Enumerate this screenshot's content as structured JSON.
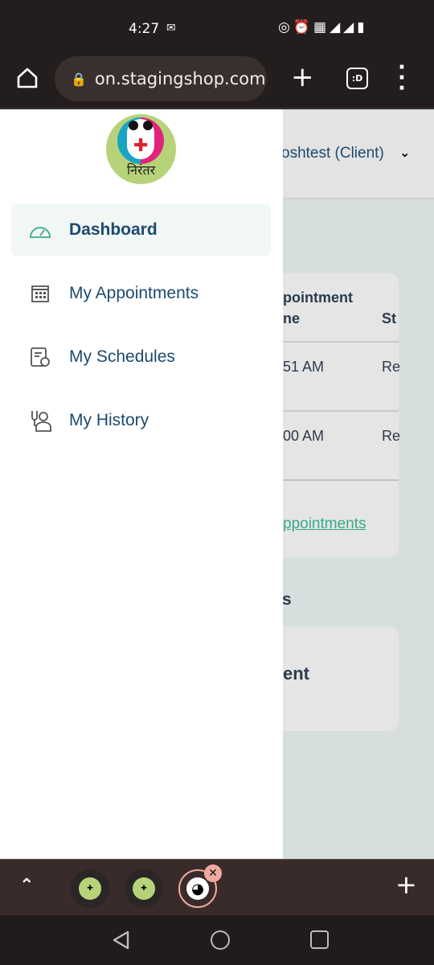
{
  "status_bar": {
    "time": "4:27",
    "icons": [
      "outlook-icon",
      "hotspot-icon",
      "alarm-icon",
      "volte-icon",
      "5g-signal-icon",
      "signal-icon",
      "battery-icon"
    ]
  },
  "browser": {
    "url": "on.stagingshop.com",
    "tab_count_label": ":D"
  },
  "background_page": {
    "user_menu": "oshtest (Client)",
    "table_header_1a": "pointment",
    "table_header_1b": "ne",
    "table_header_2": "St",
    "rows": [
      {
        "time": "51 AM",
        "status": "Re"
      },
      {
        "time": "00 AM",
        "status": "Re"
      }
    ],
    "view_all_link": "ppointments",
    "section_heading": "s",
    "card_title": "ent"
  },
  "drawer": {
    "logo_text": "निरंतर",
    "items": [
      {
        "label": "Dashboard",
        "icon": "speedometer-icon",
        "active": true
      },
      {
        "label": "My Appointments",
        "icon": "calendar-icon"
      },
      {
        "label": "My Schedules",
        "icon": "schedule-icon"
      },
      {
        "label": "My History",
        "icon": "history-icon"
      }
    ]
  },
  "colors": {
    "accent": "#3aaa8a",
    "nav_text": "#1d4a6e",
    "active_bg": "#f0f7f5",
    "chrome": "#231d1d"
  }
}
